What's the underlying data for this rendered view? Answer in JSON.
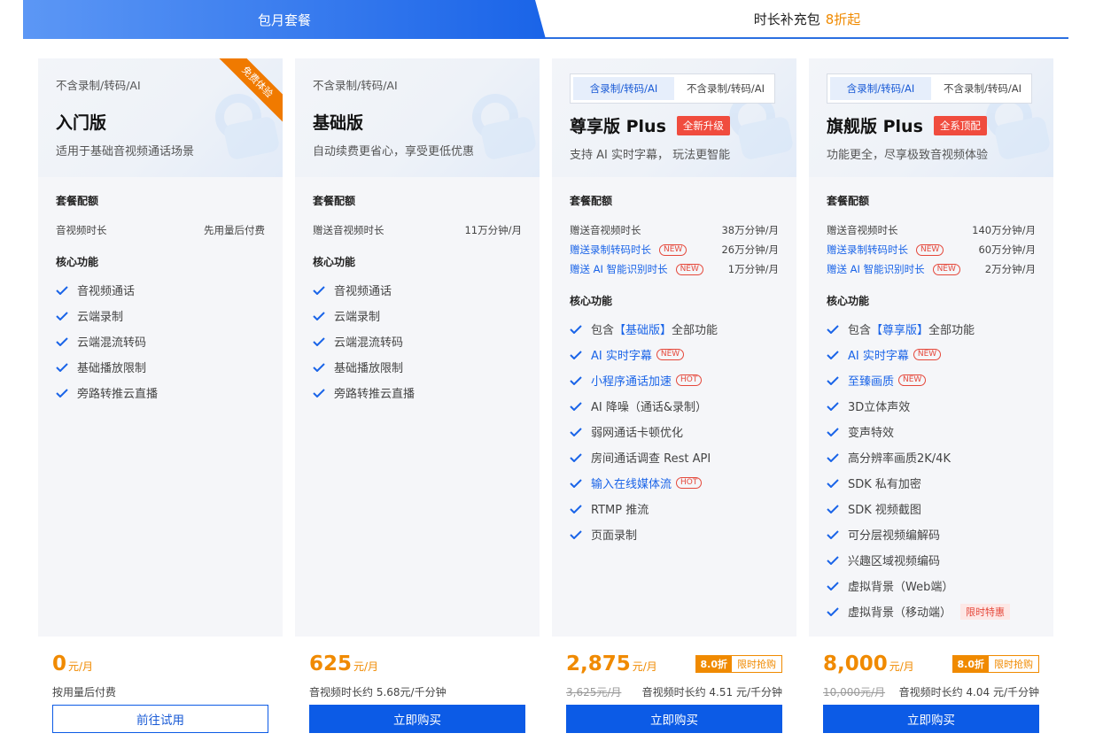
{
  "tabs": {
    "monthly": "包月套餐",
    "addon": "时长补充包",
    "addon_accent": "8折起"
  },
  "cards": [
    {
      "note": "不含录制/转码/AI",
      "corner_ribbon": "免费体验",
      "title": "入门版",
      "desc": "适用于基础音视频通话场景",
      "config_title": "套餐配额",
      "config": [
        {
          "label": "音视频时长",
          "value": "先用量后付费"
        }
      ],
      "features_title": "核心功能",
      "features": [
        "音视频通话",
        "云端录制",
        "云端混流转码",
        "基础播放限制",
        "旁路转推云直播"
      ],
      "price": "0",
      "price_unit": "元/月",
      "price_sub": "按用量后付费",
      "button": "前往试用"
    },
    {
      "note": "不含录制/转码/AI",
      "title": "基础版",
      "desc": "自动续费更省心，享受更低优惠",
      "config_title": "套餐配额",
      "config": [
        {
          "label": "赠送音视频时长",
          "value": "11万分钟/月"
        }
      ],
      "features_title": "核心功能",
      "features": [
        "音视频通话",
        "云端录制",
        "云端混流转码",
        "基础播放限制",
        "旁路转推云直播"
      ],
      "price": "625",
      "price_unit": "元/月",
      "price_sub": "音视频时长约 5.68元/千分钟",
      "button": "立即购买"
    },
    {
      "seg_a": "含录制/转码/AI",
      "seg_b": "不含录制/转码/AI",
      "title": "尊享版 Plus",
      "title_badge": "全新升级",
      "desc": "支持 AI 实时字幕， 玩法更智能",
      "config_title": "套餐配额",
      "config": [
        {
          "label": "赠送音视频时长",
          "value": "38万分钟/月"
        },
        {
          "label": "赠送录制转码时长",
          "tag": "NEW",
          "value": "26万分钟/月"
        },
        {
          "label": "赠送 AI 智能识别时长",
          "tag": "NEW",
          "value": "1万分钟/月"
        }
      ],
      "features_title": "核心功能",
      "features": [
        {
          "pre": "包含",
          "hl": "【基础版】",
          "post": "全部功能"
        },
        {
          "text": "AI 实时字幕",
          "tag": "NEW",
          "link": true
        },
        {
          "text": "小程序通话加速",
          "tag": "HOT",
          "link": true
        },
        {
          "text": "AI 降噪（通话&录制）"
        },
        {
          "text": "弱网通话卡顿优化"
        },
        {
          "text": "房间通话调查 Rest API"
        },
        {
          "text": "输入在线媒体流",
          "tag": "HOT",
          "link": true
        },
        {
          "text": "RTMP 推流"
        },
        {
          "text": "页面录制"
        }
      ],
      "price": "2,875",
      "price_unit": "元/月",
      "discount": "8.0折",
      "discount_label": "限时抢购",
      "old_price": "3,625元/月",
      "price_sub": "音视频时长约 4.51 元/千分钟",
      "button": "立即购买"
    },
    {
      "seg_a": "含录制/转码/AI",
      "seg_b": "不含录制/转码/AI",
      "title": "旗舰版 Plus",
      "title_badge": "全系顶配",
      "desc": "功能更全，尽享极致音视频体验",
      "config_title": "套餐配额",
      "config": [
        {
          "label": "赠送音视频时长",
          "value": "140万分钟/月"
        },
        {
          "label": "赠送录制转码时长",
          "tag": "NEW",
          "value": "60万分钟/月"
        },
        {
          "label": "赠送 AI 智能识别时长",
          "tag": "NEW",
          "value": "2万分钟/月"
        }
      ],
      "features_title": "核心功能",
      "features": [
        {
          "pre": "包含",
          "hl": "【尊享版】",
          "post": "全部功能"
        },
        {
          "text": "AI 实时字幕",
          "tag": "NEW",
          "link": true
        },
        {
          "text": "至臻画质",
          "tag": "NEW",
          "link": true
        },
        {
          "text": "3D立体声效"
        },
        {
          "text": "变声特效"
        },
        {
          "text": "高分辨率画质2K/4K"
        },
        {
          "text": "SDK 私有加密"
        },
        {
          "text": "SDK 视频截图"
        },
        {
          "text": "可分层视频编解码"
        },
        {
          "text": "兴趣区域视频编码"
        },
        {
          "text": "虚拟背景（Web端）"
        },
        {
          "text": "虚拟背景（移动端）",
          "tag_fill": "限时特惠"
        }
      ],
      "price": "8,000",
      "price_unit": "元/月",
      "discount": "8.0折",
      "discount_label": "限时抢购",
      "old_price": "10,000元/月",
      "price_sub": "音视频时长约 4.04 元/千分钟",
      "button": "立即购买"
    }
  ]
}
